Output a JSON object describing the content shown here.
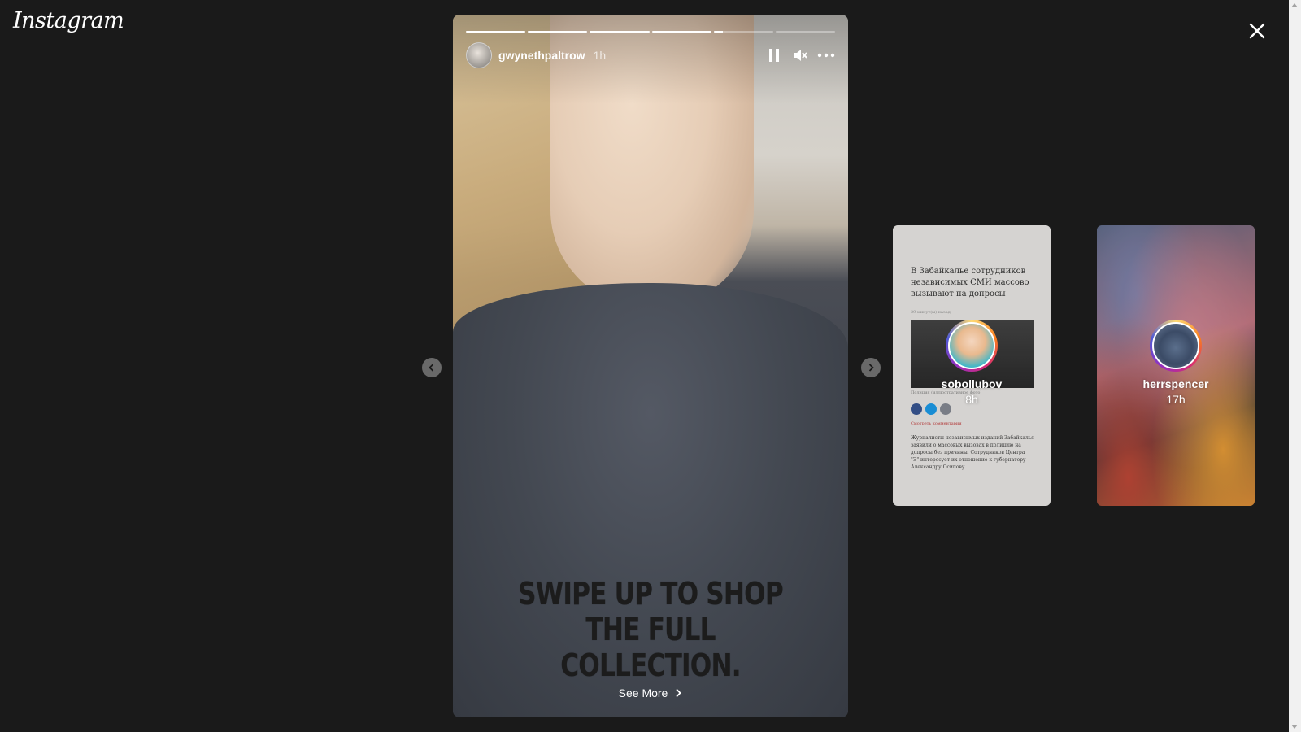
{
  "app": {
    "logo": "Instagram"
  },
  "story": {
    "username": "gwynethpaltrow",
    "timestamp": "1h",
    "caption_lines": [
      "SWIPE UP TO SHOP THE FULL",
      "COLLECTION."
    ],
    "see_more_label": "See More",
    "progress": [
      1,
      1,
      1,
      1,
      0.15,
      0
    ],
    "controls": [
      "pause-icon",
      "muted-icon",
      "more-options-icon"
    ]
  },
  "nav": {
    "prev_icon": "chevron-left-icon",
    "next_icon": "chevron-right-icon",
    "close_icon": "close-icon"
  },
  "previews": [
    {
      "username": "sobollubov",
      "time": "8h",
      "article": {
        "headline": "В Забайкалье сотрудников независимых СМИ массово вызывают на допросы",
        "meta": "29 минут(ы) назад",
        "photo_caption": "Полиция (иллюстративное фото)",
        "comments_link": "Смотреть комментарии",
        "body": "Журналисты независимых изданий Забайкалья заявили о массовых вызовах в полицию на допросы без причины. Сотрудников Центра \"Э\" интересует их отношение к губернатору Александру Осипову."
      }
    },
    {
      "username": "herrspencer",
      "time": "17h"
    }
  ],
  "colors": {
    "background": "#1a1a1a",
    "ring_gradient": [
      "#feda75",
      "#fa7e1e",
      "#d62976",
      "#962fbf",
      "#4f5bd5"
    ]
  }
}
